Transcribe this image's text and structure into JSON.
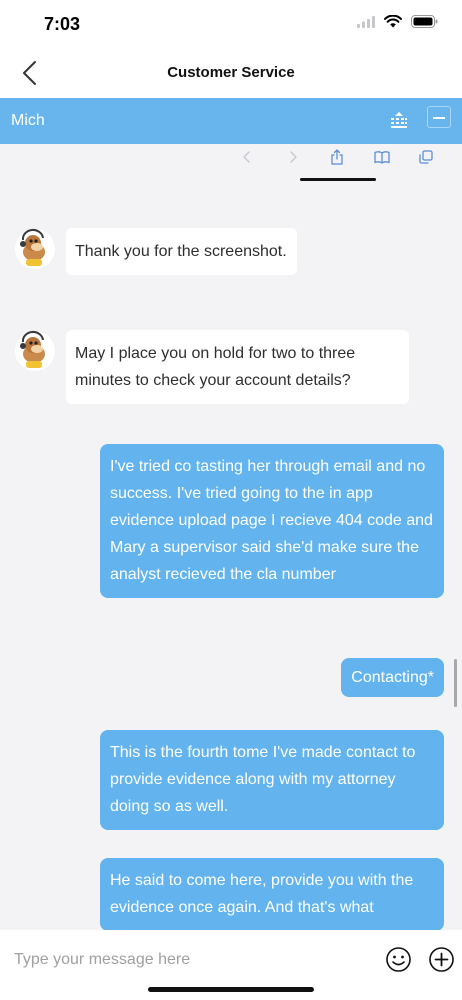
{
  "status_bar": {
    "time": "7:03"
  },
  "nav": {
    "title": "Customer Service"
  },
  "agent_bar": {
    "name": "Mich"
  },
  "messages": {
    "incoming_1": "Thank you for the screenshot.",
    "incoming_2": "May I place you on hold for  two to three minutes to check your account details?",
    "outgoing_1": "I've tried co tasting her through email and no success. I've tried going to the in app evidence upload page I recieve 404 code and Mary a supervisor said she'd make sure the analyst recieved the cla number",
    "outgoing_2": "Contacting*",
    "outgoing_3": "This is the fourth tome I've made contact to provide evidence along with my attorney doing so as well.",
    "outgoing_4": "He said to come here, provide you with the evidence once again. And that's what"
  },
  "composer": {
    "placeholder": "Type your message here"
  },
  "colors": {
    "accent": "#67b5ec",
    "outgoing_bubble": "#63b4ee",
    "incoming_bubble": "#ffffff",
    "background": "#f3f3f5"
  },
  "icons": [
    "back-arrow",
    "queue",
    "minimize",
    "browser-back",
    "browser-forward",
    "share",
    "bookmarks",
    "tabs",
    "emoji",
    "add"
  ]
}
